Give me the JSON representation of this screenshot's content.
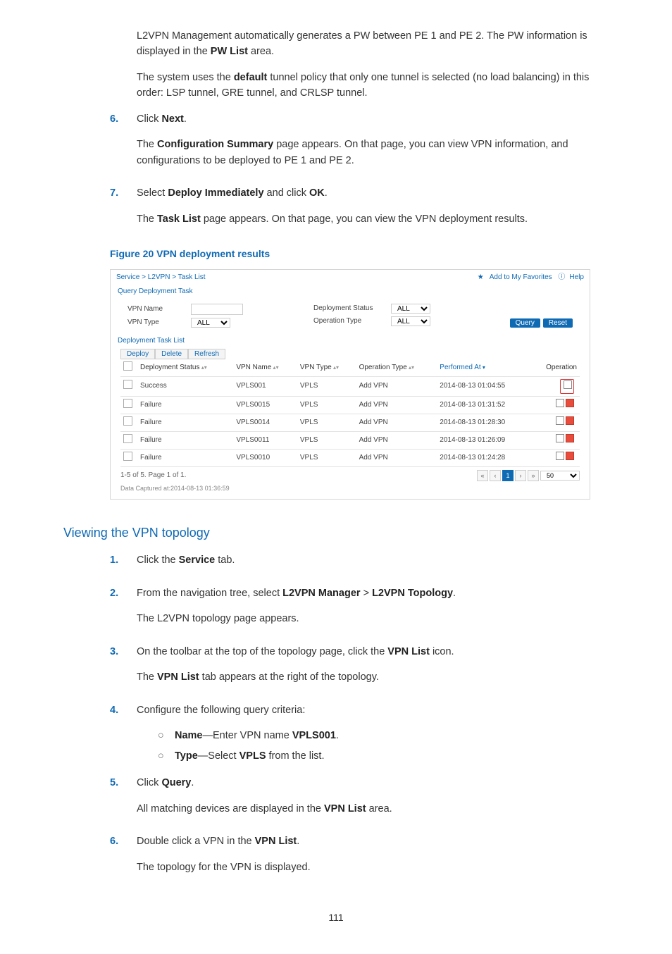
{
  "intro1_a": "L2VPN Management automatically generates a PW between PE 1 and PE 2. The PW information is displayed in the ",
  "intro1_b": "PW List",
  "intro1_c": " area.",
  "intro2_a": "The system uses the ",
  "intro2_b": "default",
  "intro2_c": " tunnel policy that only one tunnel is selected (no load balancing) in this order: LSP tunnel, GRE tunnel, and CRLSP tunnel.",
  "step6_num": "6.",
  "step6_a": "Click ",
  "step6_b": "Next",
  "step6_c": ".",
  "step6_p2_a": "The ",
  "step6_p2_b": "Configuration Summary",
  "step6_p2_c": " page appears. On that page, you can view VPN information, and configurations to be deployed to PE 1 and PE 2.",
  "step7_num": "7.",
  "step7_a": "Select ",
  "step7_b": "Deploy Immediately",
  "step7_c": " and click ",
  "step7_d": "OK",
  "step7_e": ".",
  "step7_p2_a": "The ",
  "step7_p2_b": "Task List",
  "step7_p2_c": " page appears. On that page, you can view the VPN deployment results.",
  "fig20": "Figure 20 VPN deployment results",
  "ui": {
    "breadcrumb": "Service > L2VPN > Task List",
    "addfav": "Add to My Favorites",
    "help": "Help",
    "sec_query": "Query Deployment Task",
    "lbl_vpnname": "VPN Name",
    "lbl_vpntype": "VPN Type",
    "lbl_depstatus": "Deployment Status",
    "lbl_optype": "Operation Type",
    "opt_all": "ALL",
    "btn_query": "Query",
    "btn_reset": "Reset",
    "sec_list": "Deployment Task List",
    "btn_deploy": "Deploy",
    "btn_delete": "Delete",
    "btn_refresh": "Refresh",
    "th_depstatus": "Deployment Status",
    "th_vpnname": "VPN Name",
    "th_vpntype": "VPN Type",
    "th_optype": "Operation Type",
    "th_perfat": "Performed At",
    "th_op": "Operation",
    "rows": [
      {
        "ds": "Success",
        "vn": "VPLS001",
        "vt": "VPLS",
        "ot": "Add VPN",
        "pa": "2014-08-13 01:04:55",
        "hl": true
      },
      {
        "ds": "Failure",
        "vn": "VPLS0015",
        "vt": "VPLS",
        "ot": "Add VPN",
        "pa": "2014-08-13 01:31:52",
        "hl": false
      },
      {
        "ds": "Failure",
        "vn": "VPLS0014",
        "vt": "VPLS",
        "ot": "Add VPN",
        "pa": "2014-08-13 01:28:30",
        "hl": false
      },
      {
        "ds": "Failure",
        "vn": "VPLS0011",
        "vt": "VPLS",
        "ot": "Add VPN",
        "pa": "2014-08-13 01:26:09",
        "hl": false
      },
      {
        "ds": "Failure",
        "vn": "VPLS0010",
        "vt": "VPLS",
        "ot": "Add VPN",
        "pa": "2014-08-13 01:24:28",
        "hl": false
      }
    ],
    "pagerinfo": "1-5 of 5. Page 1 of 1.",
    "pagesize": "50",
    "captured": "Data Captured at:2014-08-13 01:36:59"
  },
  "h2_topo": "Viewing the VPN topology",
  "t1_num": "1.",
  "t1_a": "Click the ",
  "t1_b": "Service",
  "t1_c": " tab.",
  "t2_num": "2.",
  "t2_a": "From the navigation tree, select ",
  "t2_b": "L2VPN Manager",
  "t2_c": " > ",
  "t2_d": "L2VPN Topology",
  "t2_e": ".",
  "t2_p2": "The L2VPN topology page appears.",
  "t3_num": "3.",
  "t3_a": "On the toolbar at the top of the topology page, click the ",
  "t3_b": "VPN List",
  "t3_c": " icon.",
  "t3_p2_a": "The ",
  "t3_p2_b": "VPN List",
  "t3_p2_c": " tab appears at the right of the topology.",
  "t4_num": "4.",
  "t4_a": "Configure the following query criteria:",
  "t4_s1_a": "Name",
  "t4_s1_b": "—Enter VPN name ",
  "t4_s1_c": "VPLS001",
  "t4_s1_d": ".",
  "t4_s2_a": "Type",
  "t4_s2_b": "—Select ",
  "t4_s2_c": "VPLS",
  "t4_s2_d": " from the list.",
  "t5_num": "5.",
  "t5_a": "Click ",
  "t5_b": "Query",
  "t5_c": ".",
  "t5_p2_a": "All matching devices are displayed in the ",
  "t5_p2_b": "VPN List",
  "t5_p2_c": " area.",
  "t6_num": "6.",
  "t6_a": "Double click a VPN in the ",
  "t6_b": "VPN List",
  "t6_c": ".",
  "t6_p2": "The topology for the VPN is displayed.",
  "pagenum": "111"
}
